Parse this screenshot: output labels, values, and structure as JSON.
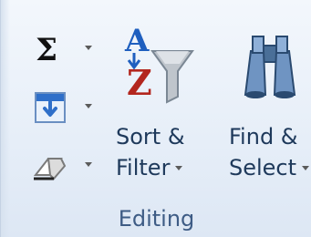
{
  "group": {
    "caption": "Editing"
  },
  "autosum": {
    "icon": "sigma-icon",
    "glyph": "Σ"
  },
  "fill": {
    "icon": "fill-down-icon"
  },
  "clear": {
    "icon": "eraser-icon"
  },
  "sort_filter": {
    "icon": "sort-az-filter-icon",
    "line1": "Sort &",
    "line2": "Filter"
  },
  "find_select": {
    "icon": "binoculars-icon",
    "line1": "Find &",
    "line2": "Select"
  },
  "colors": {
    "accent_blue": "#2f6fc9",
    "label_text": "#1e395b",
    "caption_text": "#3e5c85",
    "az_red": "#b3261e"
  }
}
